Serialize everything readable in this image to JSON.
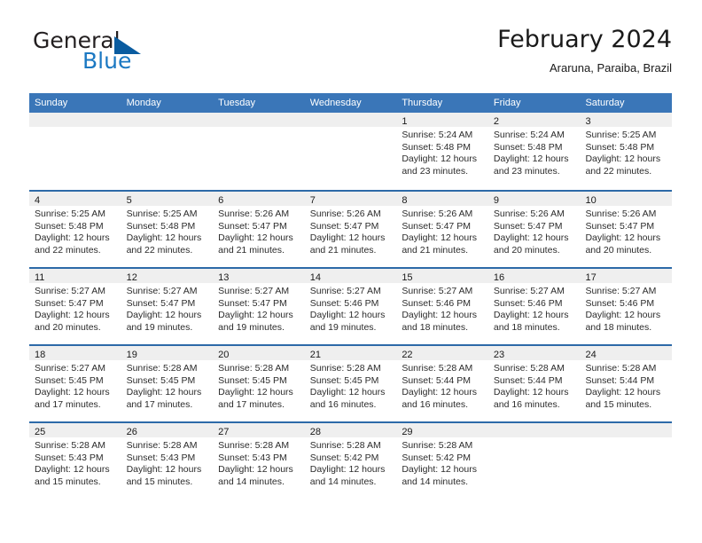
{
  "brand": {
    "word1": "General",
    "word2": "Blue",
    "mark_icon": "triangle-logo-icon"
  },
  "header": {
    "title": "February 2024",
    "location": "Araruna, Paraiba, Brazil"
  },
  "calendar": {
    "weekday_headers": [
      "Sunday",
      "Monday",
      "Tuesday",
      "Wednesday",
      "Thursday",
      "Friday",
      "Saturday"
    ],
    "colors": {
      "header_blue": "#3a76b8",
      "row_rule_blue": "#2d6aa8",
      "date_band_gray": "#efefef",
      "brand_blue": "#1b78c2"
    },
    "weeks": [
      [
        {
          "day": "",
          "empty": true
        },
        {
          "day": "",
          "empty": true
        },
        {
          "day": "",
          "empty": true
        },
        {
          "day": "",
          "empty": true
        },
        {
          "day": "1",
          "sunrise": "Sunrise: 5:24 AM",
          "sunset": "Sunset: 5:48 PM",
          "daylight1": "Daylight: 12 hours",
          "daylight2": "and 23 minutes."
        },
        {
          "day": "2",
          "sunrise": "Sunrise: 5:24 AM",
          "sunset": "Sunset: 5:48 PM",
          "daylight1": "Daylight: 12 hours",
          "daylight2": "and 23 minutes."
        },
        {
          "day": "3",
          "sunrise": "Sunrise: 5:25 AM",
          "sunset": "Sunset: 5:48 PM",
          "daylight1": "Daylight: 12 hours",
          "daylight2": "and 22 minutes."
        }
      ],
      [
        {
          "day": "4",
          "sunrise": "Sunrise: 5:25 AM",
          "sunset": "Sunset: 5:48 PM",
          "daylight1": "Daylight: 12 hours",
          "daylight2": "and 22 minutes."
        },
        {
          "day": "5",
          "sunrise": "Sunrise: 5:25 AM",
          "sunset": "Sunset: 5:48 PM",
          "daylight1": "Daylight: 12 hours",
          "daylight2": "and 22 minutes."
        },
        {
          "day": "6",
          "sunrise": "Sunrise: 5:26 AM",
          "sunset": "Sunset: 5:47 PM",
          "daylight1": "Daylight: 12 hours",
          "daylight2": "and 21 minutes."
        },
        {
          "day": "7",
          "sunrise": "Sunrise: 5:26 AM",
          "sunset": "Sunset: 5:47 PM",
          "daylight1": "Daylight: 12 hours",
          "daylight2": "and 21 minutes."
        },
        {
          "day": "8",
          "sunrise": "Sunrise: 5:26 AM",
          "sunset": "Sunset: 5:47 PM",
          "daylight1": "Daylight: 12 hours",
          "daylight2": "and 21 minutes."
        },
        {
          "day": "9",
          "sunrise": "Sunrise: 5:26 AM",
          "sunset": "Sunset: 5:47 PM",
          "daylight1": "Daylight: 12 hours",
          "daylight2": "and 20 minutes."
        },
        {
          "day": "10",
          "sunrise": "Sunrise: 5:26 AM",
          "sunset": "Sunset: 5:47 PM",
          "daylight1": "Daylight: 12 hours",
          "daylight2": "and 20 minutes."
        }
      ],
      [
        {
          "day": "11",
          "sunrise": "Sunrise: 5:27 AM",
          "sunset": "Sunset: 5:47 PM",
          "daylight1": "Daylight: 12 hours",
          "daylight2": "and 20 minutes."
        },
        {
          "day": "12",
          "sunrise": "Sunrise: 5:27 AM",
          "sunset": "Sunset: 5:47 PM",
          "daylight1": "Daylight: 12 hours",
          "daylight2": "and 19 minutes."
        },
        {
          "day": "13",
          "sunrise": "Sunrise: 5:27 AM",
          "sunset": "Sunset: 5:47 PM",
          "daylight1": "Daylight: 12 hours",
          "daylight2": "and 19 minutes."
        },
        {
          "day": "14",
          "sunrise": "Sunrise: 5:27 AM",
          "sunset": "Sunset: 5:46 PM",
          "daylight1": "Daylight: 12 hours",
          "daylight2": "and 19 minutes."
        },
        {
          "day": "15",
          "sunrise": "Sunrise: 5:27 AM",
          "sunset": "Sunset: 5:46 PM",
          "daylight1": "Daylight: 12 hours",
          "daylight2": "and 18 minutes."
        },
        {
          "day": "16",
          "sunrise": "Sunrise: 5:27 AM",
          "sunset": "Sunset: 5:46 PM",
          "daylight1": "Daylight: 12 hours",
          "daylight2": "and 18 minutes."
        },
        {
          "day": "17",
          "sunrise": "Sunrise: 5:27 AM",
          "sunset": "Sunset: 5:46 PM",
          "daylight1": "Daylight: 12 hours",
          "daylight2": "and 18 minutes."
        }
      ],
      [
        {
          "day": "18",
          "sunrise": "Sunrise: 5:27 AM",
          "sunset": "Sunset: 5:45 PM",
          "daylight1": "Daylight: 12 hours",
          "daylight2": "and 17 minutes."
        },
        {
          "day": "19",
          "sunrise": "Sunrise: 5:28 AM",
          "sunset": "Sunset: 5:45 PM",
          "daylight1": "Daylight: 12 hours",
          "daylight2": "and 17 minutes."
        },
        {
          "day": "20",
          "sunrise": "Sunrise: 5:28 AM",
          "sunset": "Sunset: 5:45 PM",
          "daylight1": "Daylight: 12 hours",
          "daylight2": "and 17 minutes."
        },
        {
          "day": "21",
          "sunrise": "Sunrise: 5:28 AM",
          "sunset": "Sunset: 5:45 PM",
          "daylight1": "Daylight: 12 hours",
          "daylight2": "and 16 minutes."
        },
        {
          "day": "22",
          "sunrise": "Sunrise: 5:28 AM",
          "sunset": "Sunset: 5:44 PM",
          "daylight1": "Daylight: 12 hours",
          "daylight2": "and 16 minutes."
        },
        {
          "day": "23",
          "sunrise": "Sunrise: 5:28 AM",
          "sunset": "Sunset: 5:44 PM",
          "daylight1": "Daylight: 12 hours",
          "daylight2": "and 16 minutes."
        },
        {
          "day": "24",
          "sunrise": "Sunrise: 5:28 AM",
          "sunset": "Sunset: 5:44 PM",
          "daylight1": "Daylight: 12 hours",
          "daylight2": "and 15 minutes."
        }
      ],
      [
        {
          "day": "25",
          "sunrise": "Sunrise: 5:28 AM",
          "sunset": "Sunset: 5:43 PM",
          "daylight1": "Daylight: 12 hours",
          "daylight2": "and 15 minutes."
        },
        {
          "day": "26",
          "sunrise": "Sunrise: 5:28 AM",
          "sunset": "Sunset: 5:43 PM",
          "daylight1": "Daylight: 12 hours",
          "daylight2": "and 15 minutes."
        },
        {
          "day": "27",
          "sunrise": "Sunrise: 5:28 AM",
          "sunset": "Sunset: 5:43 PM",
          "daylight1": "Daylight: 12 hours",
          "daylight2": "and 14 minutes."
        },
        {
          "day": "28",
          "sunrise": "Sunrise: 5:28 AM",
          "sunset": "Sunset: 5:42 PM",
          "daylight1": "Daylight: 12 hours",
          "daylight2": "and 14 minutes."
        },
        {
          "day": "29",
          "sunrise": "Sunrise: 5:28 AM",
          "sunset": "Sunset: 5:42 PM",
          "daylight1": "Daylight: 12 hours",
          "daylight2": "and 14 minutes."
        },
        {
          "day": "",
          "empty": true
        },
        {
          "day": "",
          "empty": true
        }
      ]
    ]
  }
}
